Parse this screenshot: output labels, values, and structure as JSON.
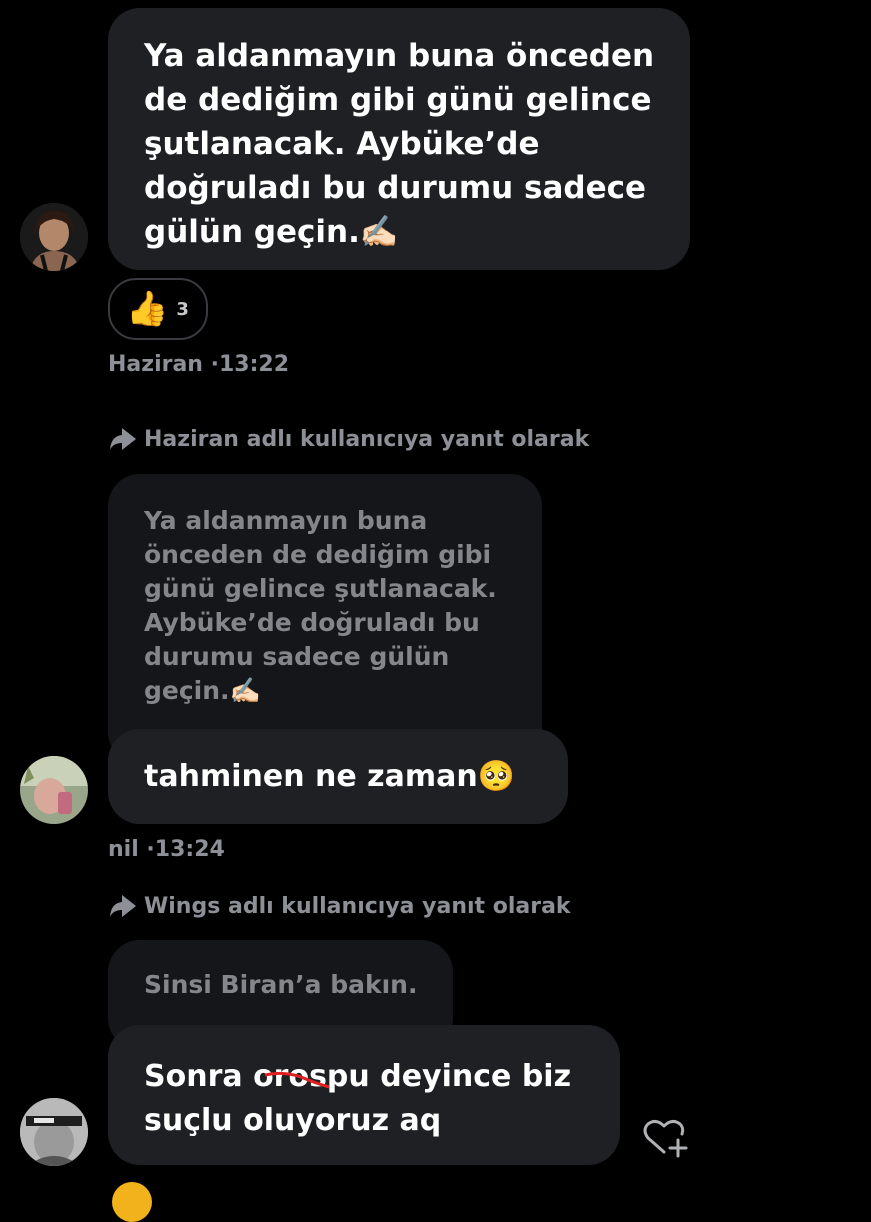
{
  "messages": [
    {
      "text": "Ya aldanmayın buna önceden de dediğim gibi günü gelince şutlanacak. Aybüke’de doğruladı bu durumu sadece gülün geçin.✍🏻",
      "reaction": {
        "emoji": "👍",
        "count": "3"
      },
      "sender": "Haziran",
      "time": "·13:22"
    },
    {
      "reply_note": "Haziran adlı kullanıcıya yanıt olarak",
      "quoted": "Ya aldanmayın buna önceden de dediğim gibi günü gelince şutlanacak. Aybüke’de doğruladı bu durumu sadece gülün geçin.✍🏻",
      "text": "tahminen ne zaman🥺",
      "sender": "nil",
      "time": "·13:24"
    },
    {
      "reply_note": "Wings adlı kullanıcıya yanıt olarak",
      "quoted": "Sinsi Biran’a bakın.",
      "text_before": "Sonra ",
      "text_struck": "orospu",
      "text_after": " deyince biz suçlu oluyoruz aq"
    }
  ],
  "colors": {
    "background": "#000000",
    "bubble": "#1f2024",
    "quoted_bubble": "#15161a",
    "meta_text": "#8e9097",
    "scribble": "#e02020"
  },
  "icons": [
    "reply-arrow-icon",
    "add-reaction-heart-icon",
    "thumbs-up-emoji"
  ]
}
